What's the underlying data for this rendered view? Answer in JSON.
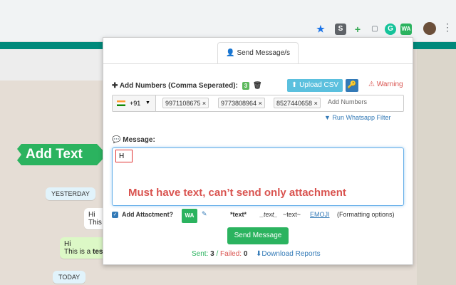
{
  "browser": {
    "extensions": [
      {
        "name": "star-icon",
        "glyph": "★",
        "color": "#1a73e8"
      },
      {
        "name": "s-extension-icon",
        "glyph": "S",
        "color": "#5f6368"
      },
      {
        "name": "plus-extension-icon",
        "glyph": "+",
        "color": "#34a853"
      },
      {
        "name": "cast-icon",
        "glyph": "▢",
        "color": "#9aa0a6"
      },
      {
        "name": "grammarly-icon",
        "glyph": "G",
        "color": "#15c39a"
      },
      {
        "name": "wa-extension-icon",
        "glyph": "WA",
        "color": "#2bb35f"
      }
    ]
  },
  "whatsapp": {
    "chips": [
      "YESTERDAY",
      "TODAY"
    ],
    "bubbles": [
      {
        "line1": "Hi",
        "line2": "This"
      },
      {
        "line1": "Hi",
        "line2_prefix": "This is a ",
        "line2_bold": "tes"
      }
    ]
  },
  "callout": {
    "text": "Add Text"
  },
  "popup": {
    "tab_label": "Send Message/s",
    "add_numbers_label": "Add Numbers (Comma Seperated):",
    "count": "3",
    "upload_label": "Upload CSV",
    "warning_label": "Warning",
    "country_code": "+91",
    "numbers": [
      "9971108675",
      "9773808964",
      "8527440658"
    ],
    "add_numbers_placeholder": "Add Numbers",
    "filter_label": "Run Whatsapp Filter",
    "message_label": "Message:",
    "message_value": "H",
    "note": "Must have text, can’t send only attachment",
    "attach_label": "Add Attactment?",
    "attach_badge": "WA",
    "fmt_bold": "*text*",
    "fmt_italic": "_text_",
    "fmt_strike": "~text~",
    "fmt_emoji": "EMOJI",
    "fmt_options": "(Formatting options)",
    "send_label": "Send Message",
    "sent_label": "Sent:",
    "sent_count": "3",
    "failed_label": "Failed:",
    "failed_count": "0",
    "download_label": "Download Reports"
  },
  "colors": {
    "brand": "#2bb35f",
    "header": "#00897b",
    "warning": "#d9534f",
    "link": "#337ab7"
  }
}
